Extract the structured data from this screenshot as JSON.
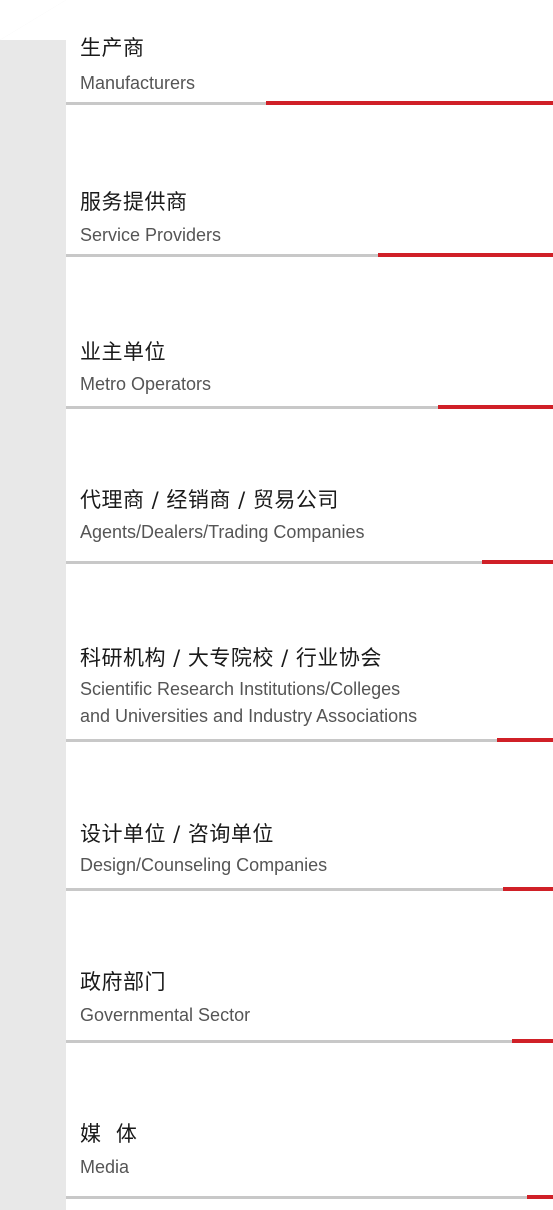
{
  "colors": {
    "accent": "#d02027",
    "divider": "#c8c8c8",
    "side_strip": "#e8e8e8"
  },
  "categories": [
    {
      "zh": "生产商",
      "en": "Manufacturers"
    },
    {
      "zh": "服务提供商",
      "en": "Service Providers"
    },
    {
      "zh": "业主单位",
      "en": "Metro Operators"
    },
    {
      "zh": "代理商 / 经销商 / 贸易公司",
      "en": "Agents/Dealers/Trading Companies"
    },
    {
      "zh": "科研机构 / 大专院校 / 行业协会",
      "en": "Scientific Research Institutions/Colleges",
      "en2": "and Universities and Industry Associations"
    },
    {
      "zh": "设计单位 / 咨询单位",
      "en": "Design/Counseling Companies"
    },
    {
      "zh": "政府部门",
      "en": "Governmental Sector"
    },
    {
      "zh": "媒  体",
      "en": "Media"
    }
  ]
}
